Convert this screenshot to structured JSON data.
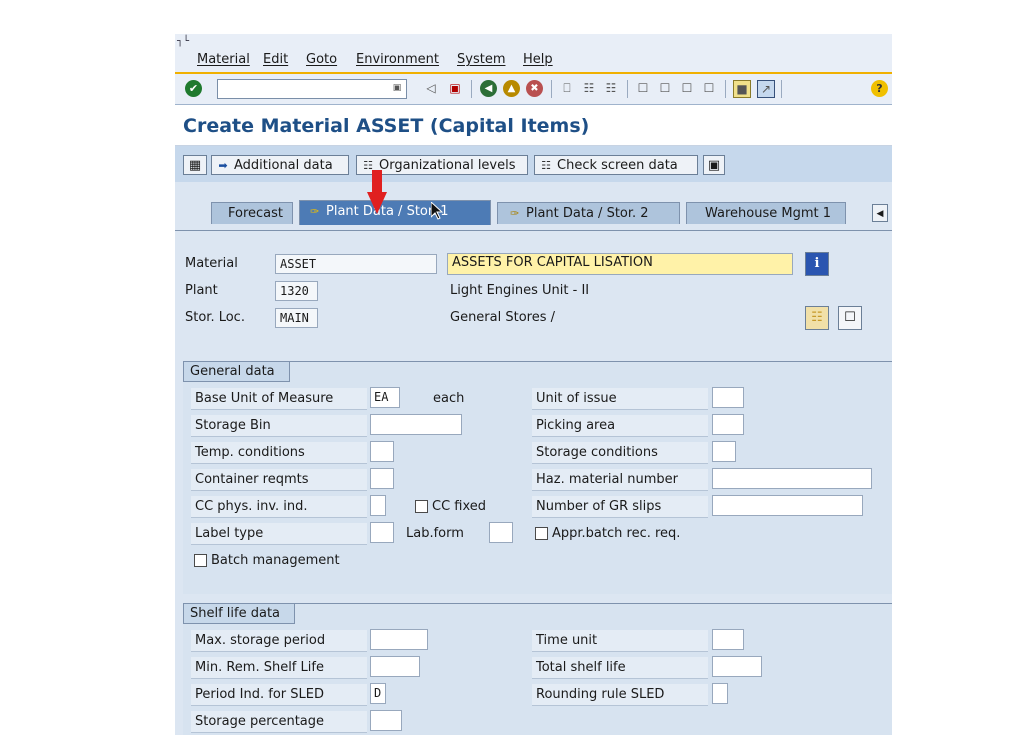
{
  "menu": [
    "Material",
    "Edit",
    "Goto",
    "Environment",
    "System",
    "Help"
  ],
  "toolbar": {
    "command_value": ""
  },
  "title": "Create Material ASSET (Capital Items)",
  "app_toolbar": {
    "additional_data": "Additional data",
    "org_levels": "Organizational levels",
    "check_screen": "Check screen data"
  },
  "tabs": [
    "Forecast",
    "Plant Data / Stor. 1",
    "Plant Data / Stor. 2",
    "Warehouse Mgmt 1"
  ],
  "header": {
    "material_label": "Material",
    "material_value": "ASSET",
    "material_desc": "ASSETS FOR CAPITAL LISATION",
    "plant_label": "Plant",
    "plant_value": "1320",
    "plant_desc": "Light Engines Unit - II",
    "storloc_label": "Stor. Loc.",
    "storloc_value": "MAIN",
    "storloc_desc": "General Stores /"
  },
  "general": {
    "title": "General data",
    "base_uom_label": "Base Unit of Measure",
    "base_uom_value": "EA",
    "base_uom_text": "each",
    "storage_bin_label": "Storage Bin",
    "temp_cond_label": "Temp. conditions",
    "container_label": "Container reqmts",
    "cc_phys_label": "CC phys. inv. ind.",
    "cc_fixed_label": "CC fixed",
    "label_type_label": "Label type",
    "lab_form_label": "Lab.form",
    "batch_mgmt_label": "Batch management",
    "unit_issue_label": "Unit of issue",
    "picking_area_label": "Picking area",
    "storage_cond_label": "Storage conditions",
    "haz_label": "Haz. material number",
    "gr_slips_label": "Number of GR slips",
    "appr_batch_label": "Appr.batch rec. req."
  },
  "shelf": {
    "title": "Shelf life data",
    "max_storage_label": "Max. storage period",
    "min_rem_label": "Min. Rem. Shelf Life",
    "period_ind_label": "Period Ind. for SLED",
    "period_ind_value": "D",
    "storage_pct_label": "Storage percentage",
    "time_unit_label": "Time unit",
    "total_shelf_label": "Total shelf life",
    "rounding_label": "Rounding rule SLED"
  }
}
